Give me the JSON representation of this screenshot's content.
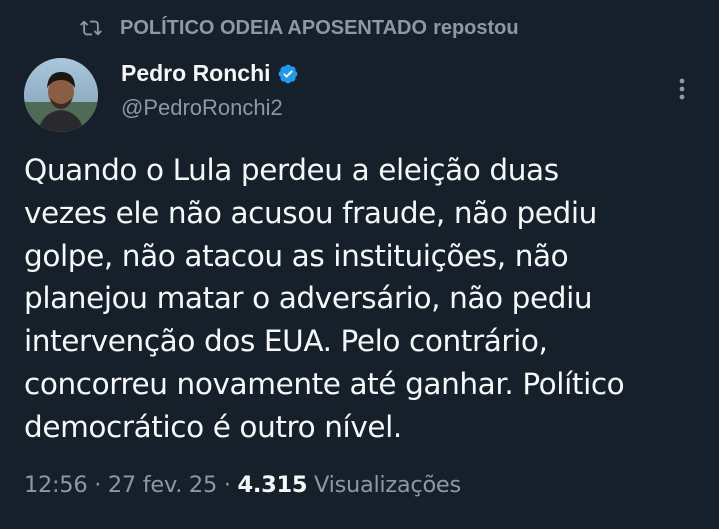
{
  "repost": {
    "reposter": "POLÍTICO ODEIA APOSENTADO",
    "suffix": "repostou"
  },
  "author": {
    "name": "Pedro Ronchi",
    "handle": "@PedroRonchi2",
    "verified": true
  },
  "tweet": {
    "lines": [
      "Quando o Lula perdeu a eleição duas",
      "vezes ele não acusou fraude, não pediu",
      "golpe, não atacou as instituições, não",
      "planejou matar o adversário, não pediu",
      "intervenção dos EUA. Pelo contrário,",
      "concorreu novamente até ganhar. Político",
      "democrático é outro nível."
    ]
  },
  "meta": {
    "time": "12:56",
    "sep1": " · ",
    "date": "27 fev. 25",
    "sep2": " · ",
    "views_count": "4.315",
    "views_label": " Visualizações"
  },
  "colors": {
    "background": "#15202b",
    "text": "#f7f9f9",
    "secondary": "#8b98a5",
    "verified": "#1d9bf0"
  },
  "icons": {
    "repost": "repost-icon",
    "verified": "verified-badge-icon",
    "more": "more-vertical-icon"
  }
}
